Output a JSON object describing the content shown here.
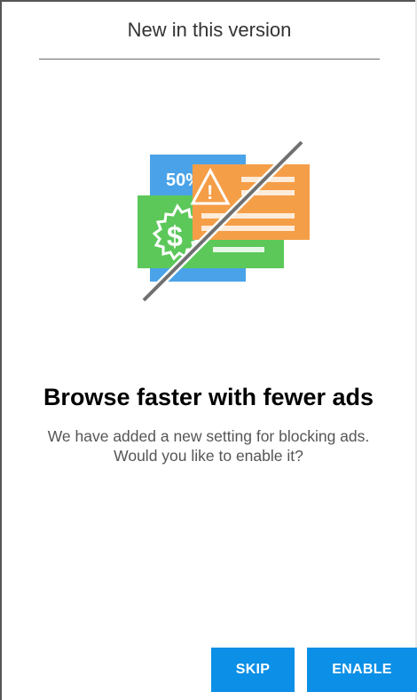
{
  "dialog": {
    "title": "New in this version",
    "illustration": {
      "badge_text": "50%",
      "currency_symbol": "$",
      "warning_symbol": "!"
    },
    "headline": "Browse faster with fewer ads",
    "body": "We have added a new setting for blocking ads. Would you like to enable it?",
    "buttons": {
      "skip_label": "SKIP",
      "enable_label": "ENABLE"
    }
  },
  "colors": {
    "accent": "#0c8fe6",
    "blue_card": "#4aa3e8",
    "green_card": "#5cc85a",
    "orange_card": "#f59e48",
    "slash": "#707070"
  },
  "icons": [
    "ad-cards-illustration",
    "warning-icon",
    "dollar-badge-icon",
    "slash-line"
  ]
}
